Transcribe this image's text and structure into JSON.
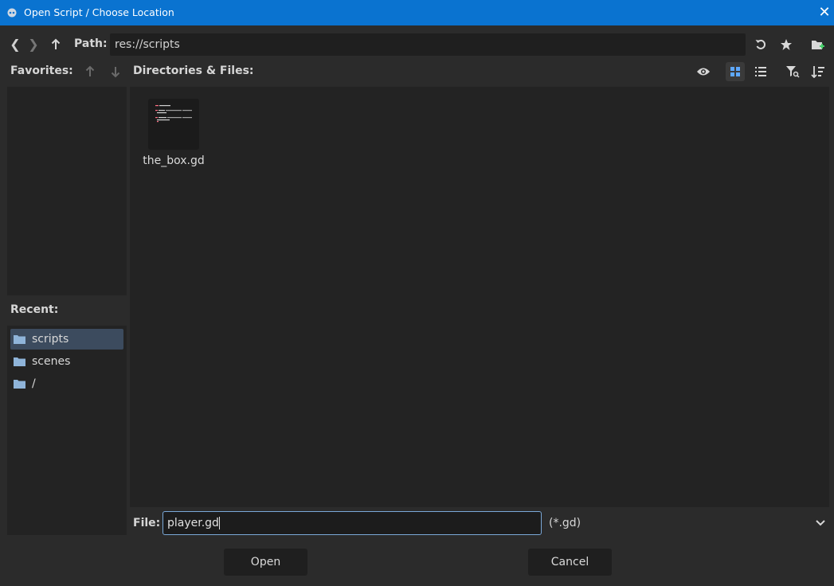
{
  "window": {
    "title": "Open Script / Choose Location",
    "close_glyph": "✕"
  },
  "toolbar": {
    "back_glyph": "❮",
    "forward_glyph": "❯",
    "path_label": "Path:",
    "path_value": "res://scripts",
    "icons": [
      "back-icon",
      "forward-icon",
      "up-icon",
      "refresh-icon",
      "favorite-icon",
      "new-folder-icon"
    ]
  },
  "favorites": {
    "label": "Favorites:",
    "items": []
  },
  "directories": {
    "label": "Directories & Files:",
    "files": [
      {
        "name": "the_box.gd",
        "type": "script"
      }
    ],
    "view_mode": "grid"
  },
  "recent": {
    "label": "Recent:",
    "items": [
      {
        "label": "scripts",
        "selected": true
      },
      {
        "label": "scenes",
        "selected": false
      },
      {
        "label": "/",
        "selected": false
      }
    ]
  },
  "file_row": {
    "label": "File:",
    "value": "player.gd",
    "filter": "(*.gd)"
  },
  "buttons": {
    "open": "Open",
    "cancel": "Cancel"
  },
  "colors": {
    "titlebar": "#0a73d0",
    "background": "#2b2b2b",
    "panel": "#232323",
    "selection": "#3c4b5e",
    "folder_icon": "#8fb4d9",
    "accent_green": "#45d06a"
  }
}
